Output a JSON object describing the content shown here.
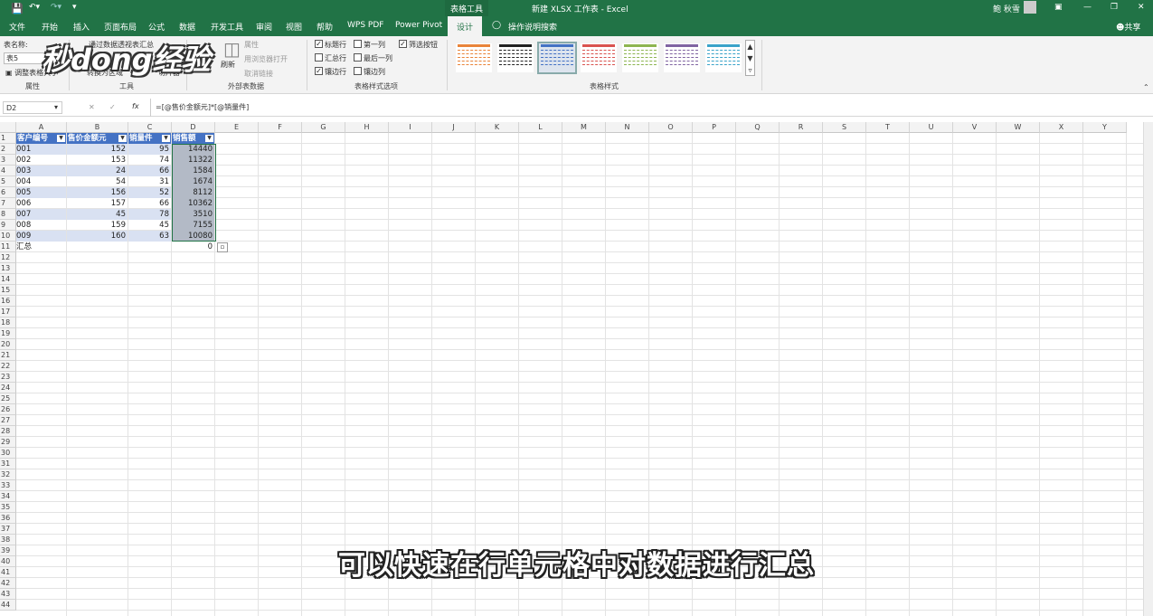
{
  "titlebar": {
    "save_icon": "save-icon",
    "table_tools": "表格工具",
    "doc_title": "新建 XLSX 工作表 - Excel",
    "user": "鲍 秋雪"
  },
  "tabs": [
    "文件",
    "开始",
    "插入",
    "页面布局",
    "公式",
    "数据",
    "开发工具",
    "审阅",
    "视图",
    "帮助",
    "WPS PDF",
    "Power Pivot",
    "设计"
  ],
  "tab_active": "设计",
  "tell_me": "操作说明搜索",
  "share": "共享",
  "ribbon": {
    "table_name_label": "表名称:",
    "table_name_value": "表5",
    "resize": "调整表格大小",
    "summarize": "通过数据透视表汇总",
    "convert": "转换为区域",
    "slicer": "切片器",
    "refresh": "刷新",
    "properties": "属性",
    "open_browser": "用浏览器打开",
    "unlink": "取消链接",
    "opt_header": "标题行",
    "opt_first_col": "第一列",
    "opt_filter": "筛选按钮",
    "opt_total": "汇总行",
    "opt_last_col": "最后一列",
    "opt_banded_rows": "镶边行",
    "opt_banded_cols": "镶边列",
    "grp_properties": "属性",
    "grp_tools": "工具",
    "grp_external": "外部表数据",
    "grp_options": "表格样式选项",
    "grp_styles": "表格样式",
    "checked": {
      "opt_header": true,
      "opt_first_col": false,
      "opt_filter": true,
      "opt_total": false,
      "opt_last_col": false,
      "opt_banded_rows": true,
      "opt_banded_cols": false
    },
    "style_colors": [
      "#e9843a",
      "#222222",
      "#4472c4",
      "#d9534f",
      "#8db550",
      "#8064a2",
      "#3aa3c9"
    ]
  },
  "logo": "秒dong经验",
  "formula_bar": {
    "name_box": "D2",
    "fx": "fx",
    "formula": "=[@售价金额元]*[@销量件]"
  },
  "columns": [
    "A",
    "B",
    "C",
    "D",
    "E",
    "F",
    "G",
    "H",
    "I",
    "J",
    "K",
    "L",
    "M",
    "N",
    "O",
    "P",
    "Q",
    "R",
    "S",
    "T",
    "U",
    "V",
    "W",
    "X",
    "Y"
  ],
  "rows": [
    "1",
    "2",
    "3",
    "4",
    "5",
    "6",
    "7",
    "8",
    "9",
    "10",
    "11",
    "12",
    "13",
    "14",
    "15",
    "16",
    "17",
    "18",
    "19",
    "20",
    "21",
    "22",
    "23",
    "24",
    "25",
    "26",
    "27",
    "28",
    "29",
    "30",
    "31",
    "32",
    "33",
    "34",
    "35",
    "36",
    "37",
    "38",
    "39",
    "40",
    "41",
    "42",
    "43",
    "44"
  ],
  "table": {
    "headers": [
      "客户编号",
      "售价金额元",
      "销量件",
      "销售额"
    ],
    "rows": [
      [
        "001",
        "152",
        "95",
        "14440"
      ],
      [
        "002",
        "153",
        "74",
        "11322"
      ],
      [
        "003",
        "24",
        "66",
        "1584"
      ],
      [
        "004",
        "54",
        "31",
        "1674"
      ],
      [
        "005",
        "156",
        "52",
        "8112"
      ],
      [
        "006",
        "157",
        "66",
        "10362"
      ],
      [
        "007",
        "45",
        "78",
        "3510"
      ],
      [
        "008",
        "159",
        "45",
        "7155"
      ],
      [
        "009",
        "160",
        "63",
        "10080"
      ]
    ],
    "total_label": "汇总",
    "total_value": "0"
  },
  "caption": "可以快速在行单元格中对数据进行汇总"
}
